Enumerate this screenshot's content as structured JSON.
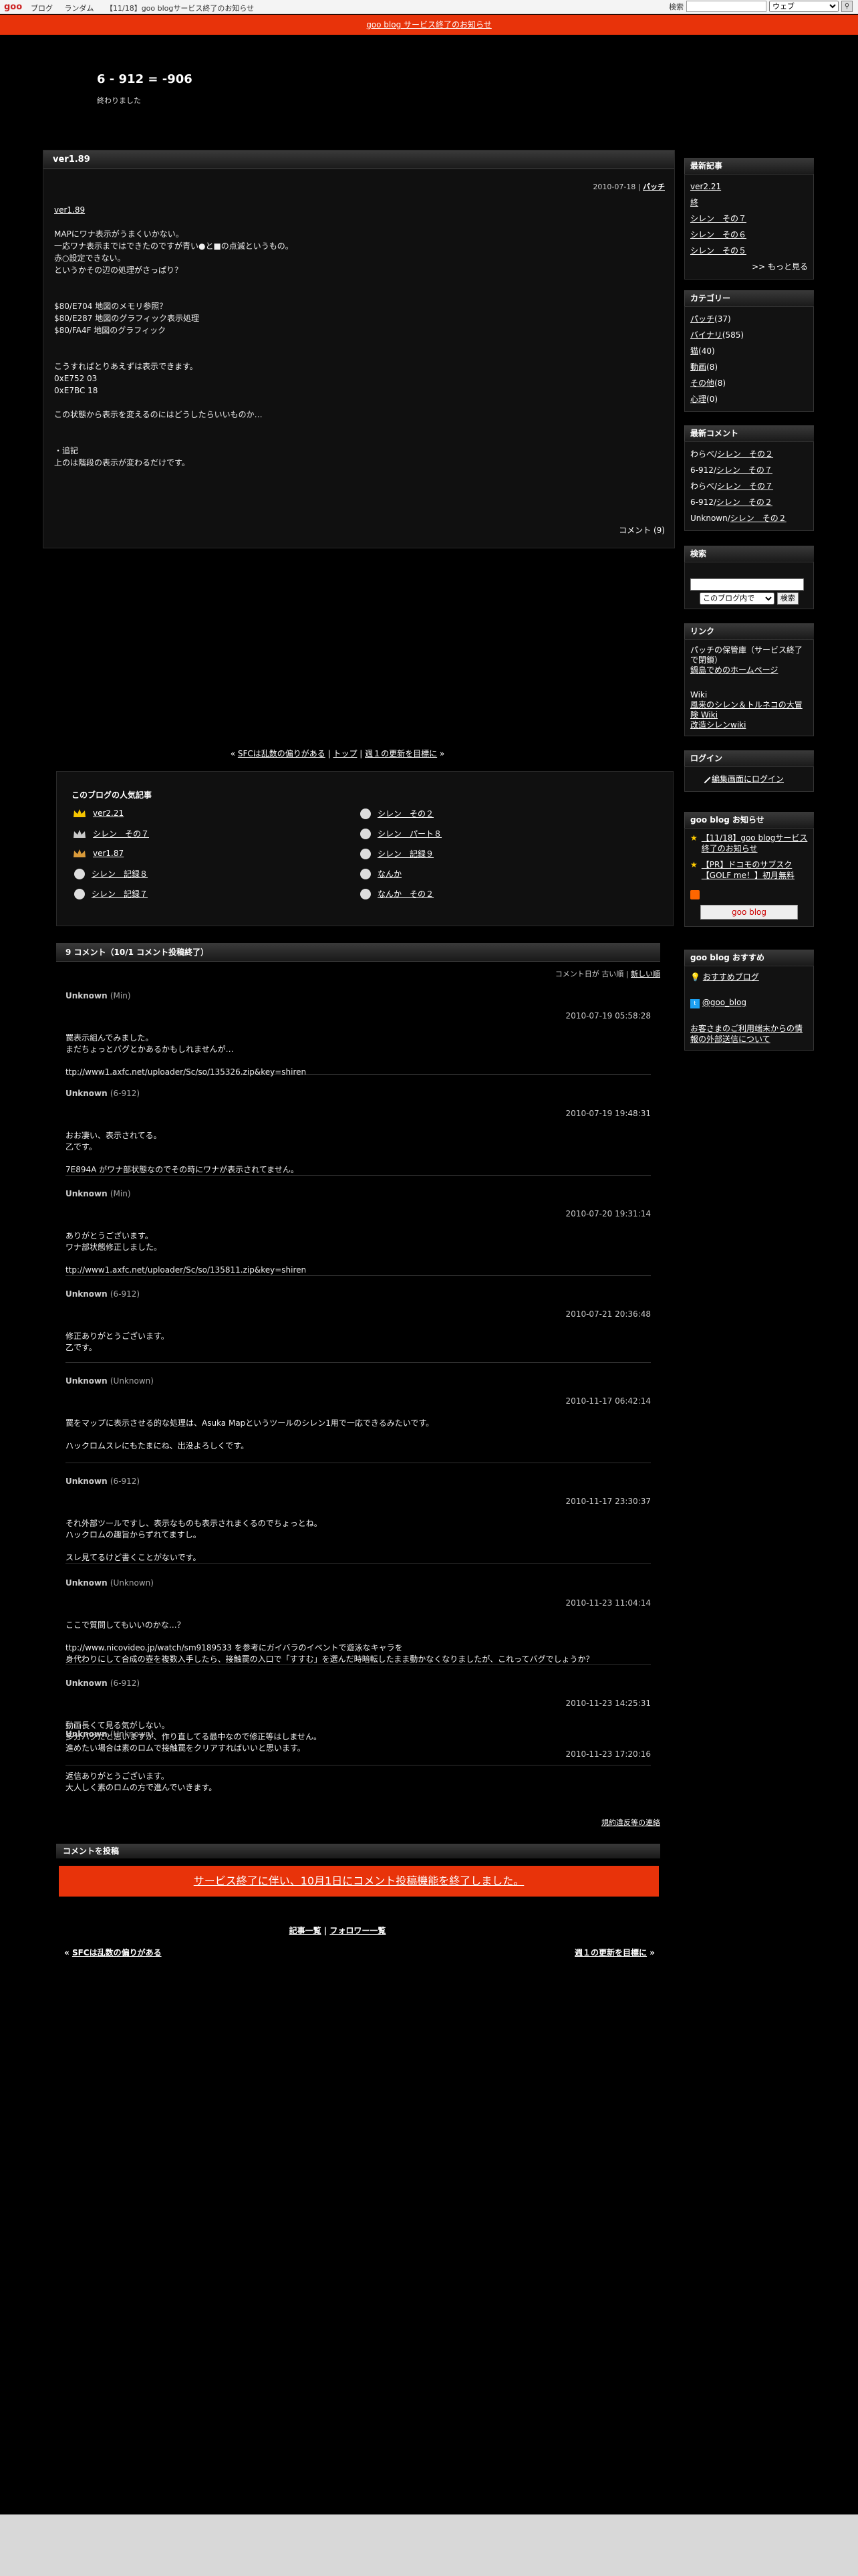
{
  "topbar": {
    "logo": "goo",
    "nav": [
      "ブログ",
      "ランダム",
      "【11/18】goo blogサービス終了のお知らせ"
    ],
    "search_label": "検索",
    "search_placeholder": "",
    "scope": "ウェブ"
  },
  "notice": {
    "text": "goo blog サービス終了のお知らせ"
  },
  "blog": {
    "title": "6 - 912 = -906",
    "subtitle": "終わりました"
  },
  "entry": {
    "title": "ver1.89",
    "date": "2010-07-18",
    "category": "パッチ",
    "link": "ver1.89",
    "lines": [
      "MAPにワナ表示がうまくいかない。",
      "一応ワナ表示まではできたのですが青い●と■の点滅というもの。",
      "赤○設定できない。",
      "というかその辺の処理がさっぱり？",
      "",
      "",
      "$80/E704 地図のメモリ参照？",
      "$80/E287 地図のグラフィック表示処理",
      "$80/FA4F 地図のグラフィック",
      "",
      "",
      "こうすればとりあえずは表示できます。",
      "0xE752 03",
      "0xE7BC 18",
      "",
      "この状態から表示を変えるのにはどうしたらいいものか…",
      "",
      "",
      "・追記",
      "上のは階段の表示が変わるだけです。"
    ],
    "comment_link": "コメント (9)"
  },
  "pager": {
    "prev": "SFCは乱数の偏りがある",
    "top": "トップ",
    "next": "週１の更新を目標に"
  },
  "popular": {
    "heading": "このブログの人気記事",
    "left": [
      "ver2.21",
      "シレン　その７",
      "ver1.87",
      "シレン　記録８",
      "シレン　記録７"
    ],
    "right": [
      "シレン　その２",
      "シレン　パート８",
      "シレン　記録９",
      "なんか",
      "なんか　その２"
    ]
  },
  "comments": {
    "heading": "9 コメント（10/1 コメント投稿終了）",
    "sort_label": "コメント日が",
    "sort_old": "古い順",
    "sort_new": "新しい順",
    "items": [
      {
        "name": "Unknown",
        "handle": "(Min)",
        "time": "2010-07-19 05:58:28",
        "text": "罠表示組んでみました。\nまだちょっとバグとかあるかもしれませんが…\n\nttp://www1.axfc.net/uploader/Sc/so/135326.zip&key=shiren"
      },
      {
        "name": "Unknown",
        "handle": "(6-912)",
        "time": "2010-07-19 19:48:31",
        "text": "おお凄い、表示されてる。\n乙です。\n\n7E894A がワナ部状態なのでその時にワナが表示されてません。"
      },
      {
        "name": "Unknown",
        "handle": "(Min)",
        "time": "2010-07-20 19:31:14",
        "text": "ありがとうございます。\nワナ部状態修正しました。\n\nttp://www1.axfc.net/uploader/Sc/so/135811.zip&key=shiren"
      },
      {
        "name": "Unknown",
        "handle": "(6-912)",
        "time": "2010-07-21 20:36:48",
        "text": "修正ありがとうございます。\n乙です。"
      },
      {
        "name": "Unknown",
        "handle": "(Unknown)",
        "time": "2010-11-17 06:42:14",
        "text": "罠をマップに表示させる的な処理は、Asuka Mapというツールのシレン1用で一応できるみたいです。\n\nハックロムスレにもたまにね、出没よろしくです。"
      },
      {
        "name": "Unknown",
        "handle": "(6-912)",
        "time": "2010-11-17 23:30:37",
        "text": "それ外部ツールですし、表示なものも表示されまくるのでちょっとね。\nハックロムの趣旨からずれてますし。\n\nスレ見てるけど書くことがないです。"
      },
      {
        "name": "Unknown",
        "handle": "(Unknown)",
        "time": "2010-11-23 11:04:14",
        "text": "ここで質問してもいいのかな…？\n\nttp://www.nicovideo.jp/watch/sm9189533 を参考にガイバラのイベントで遊泳なキャラを\n身代わりにして合成の壺を複数入手したら、接触罠の入口で「すすむ」を選んだ時暗転したまま動かなくなりましたが、これってバグでしょうか？"
      },
      {
        "name": "Unknown",
        "handle": "(6-912)",
        "time": "2010-11-23 14:25:31",
        "text": "動画長くて見る気がしない。\n多分バグだと思いますが、作り直してる最中なので修正等はしません。\n進めたい場合は素のロムで接触罠をクリアすればいいと思います。"
      },
      {
        "name": "Unknown",
        "handle": "(Unknown)",
        "time": "2010-11-23 17:20:16",
        "text": "返信ありがとうございます。\n大人しく素のロムの方で進んでいきます。"
      }
    ]
  },
  "rules_link": "規約違反等の連絡",
  "post": {
    "heading": "コメントを投稿",
    "closed": "サービス終了に伴い、10月1日にコメント投稿機能を終了しました。"
  },
  "footer": {
    "list": "記事一覧",
    "followers": "フォロワー一覧",
    "prev": "SFCは乱数の偏りがある",
    "next": "週１の更新を目標に"
  },
  "sidebar": {
    "recent": {
      "heading": "最新記事",
      "items": [
        "ver2.21",
        "終",
        "シレン　その７",
        "シレン　その６",
        "シレン　その５"
      ],
      "more": ">> もっと見る"
    },
    "categories": {
      "heading": "カテゴリー",
      "items": [
        {
          "name": "パッチ",
          "count": "(37)"
        },
        {
          "name": "バイナリ",
          "count": "(585)"
        },
        {
          "name": "猫",
          "count": "(40)"
        },
        {
          "name": "動画",
          "count": "(8)"
        },
        {
          "name": "その他",
          "count": "(8)"
        },
        {
          "name": "心理",
          "count": "(0)"
        }
      ]
    },
    "recent_comments": {
      "heading": "最新コメント",
      "items": [
        {
          "who": "わらべ/",
          "link": "シレン　その２"
        },
        {
          "who": "6-912/",
          "link": "シレン　その７"
        },
        {
          "who": "わらべ/",
          "link": "シレン　その７"
        },
        {
          "who": "6-912/",
          "link": "シレン　その２"
        },
        {
          "who": "Unknown/",
          "link": "シレン　その２"
        }
      ]
    },
    "search": {
      "heading": "検索",
      "scope": "このブログ内で",
      "button": "検索"
    },
    "links": {
      "heading": "リンク",
      "lines": [
        "パッチの保管庫（サービス終了で閉鎖）",
        "鍋島でめのホームページ",
        "",
        "Wiki",
        "風来のシレン＆トルネコの大冒険 Wiki",
        "改造シレンwiki"
      ]
    },
    "login": {
      "heading": "ログイン",
      "link": "編集画面にログイン"
    },
    "goo_notice": {
      "heading": "goo blog お知らせ",
      "items": [
        "【11/18】goo blogサービス終了のお知らせ",
        "【PR】ドコモのサブスク【GOLF me！】初月無料"
      ],
      "button": "goo blog"
    },
    "recommend": {
      "heading": "goo blog おすすめ",
      "item": "おすすめブログ",
      "twitter": "@goo_blog",
      "contact": "お客さまのご利用端末からの情報の外部送信について"
    }
  }
}
